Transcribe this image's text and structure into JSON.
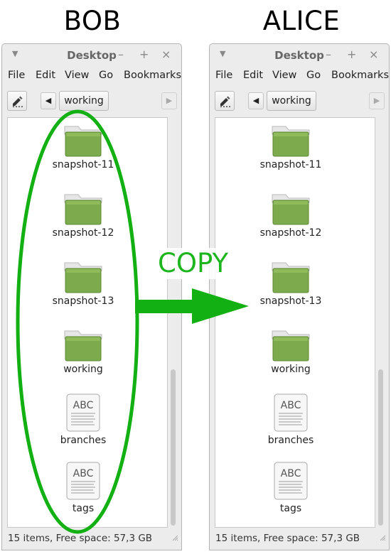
{
  "headings": {
    "left": "BOB",
    "right": "ALICE"
  },
  "annotation": {
    "copy_label": "COPY",
    "color": "#12b012"
  },
  "bob_window": {
    "title": "Desktop",
    "controls": {
      "minimize": "–",
      "maximize": "+",
      "close": "×"
    },
    "menu": [
      "File",
      "Edit",
      "View",
      "Go",
      "Bookmarks"
    ],
    "path_button": "working",
    "items": [
      {
        "label": "snapshot-11",
        "type": "folder"
      },
      {
        "label": "snapshot-12",
        "type": "folder"
      },
      {
        "label": "snapshot-13",
        "type": "folder"
      },
      {
        "label": "working",
        "type": "folder"
      },
      {
        "label": "branches",
        "type": "text-file",
        "icon_text": "ABC"
      },
      {
        "label": "tags",
        "type": "text-file",
        "icon_text": "ABC"
      }
    ],
    "status": "15 items, Free space: 57,3 GB"
  },
  "alice_window": {
    "title": "Desktop",
    "controls": {
      "minimize": "–",
      "maximize": "+",
      "close": "×"
    },
    "menu": [
      "File",
      "Edit",
      "View",
      "Go",
      "Bookmarks"
    ],
    "path_button": "working",
    "items": [
      {
        "label": "snapshot-11",
        "type": "folder"
      },
      {
        "label": "snapshot-12",
        "type": "folder"
      },
      {
        "label": "snapshot-13",
        "type": "folder"
      },
      {
        "label": "working",
        "type": "folder"
      },
      {
        "label": "branches",
        "type": "text-file",
        "icon_text": "ABC"
      },
      {
        "label": "tags",
        "type": "text-file",
        "icon_text": "ABC"
      }
    ],
    "status": "15 items, Free space: 57,3 GB"
  },
  "colors": {
    "folder_green": "#7eaa4e",
    "annotation_green": "#12b012"
  }
}
